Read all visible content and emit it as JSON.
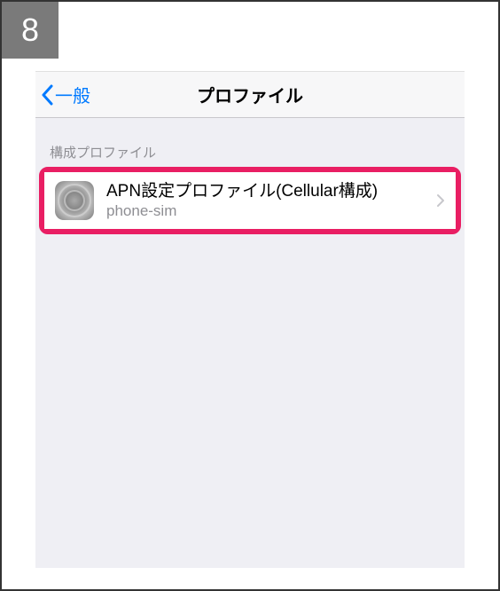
{
  "step": "8",
  "nav": {
    "back_label": "一般",
    "title": "プロファイル"
  },
  "section": {
    "header": "構成プロファイル"
  },
  "profile_row": {
    "title": "APN設定プロファイル(Cellular構成)",
    "subtitle": "phone-sim",
    "icon_name": "settings-gear-icon"
  }
}
